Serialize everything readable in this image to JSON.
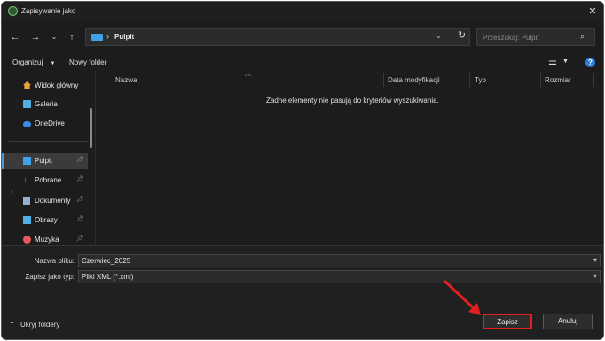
{
  "window": {
    "title": "Zapisywanie jako"
  },
  "nav": {
    "back_icon": "arrow-left-icon",
    "forward_icon": "arrow-right-icon",
    "recent_icon": "chevron-down-icon",
    "up_icon": "arrow-up-icon"
  },
  "address": {
    "path": "Pulpit"
  },
  "search": {
    "placeholder": "Przeszukaj: Pulpit"
  },
  "toolbar": {
    "organize_label": "Organizuj",
    "new_folder_label": "Nowy folder"
  },
  "sidebar": {
    "items": [
      {
        "label": "Widok główny",
        "icon": "home-icon",
        "color": "#e8a33a"
      },
      {
        "label": "Galeria",
        "icon": "gallery-icon",
        "color": "#4fb0e8"
      },
      {
        "label": "OneDrive",
        "icon": "cloud-icon",
        "color": "#3b8ee8"
      },
      {
        "label": "Pulpit",
        "icon": "desktop-folder-icon",
        "color": "#3fa3e8"
      },
      {
        "label": "Pobrane",
        "icon": "download-icon",
        "color": "#3fbf7f"
      },
      {
        "label": "Dokumenty",
        "icon": "documents-icon",
        "color": "#8fb0d0"
      },
      {
        "label": "Obrazy",
        "icon": "pictures-icon",
        "color": "#4fb0e8"
      },
      {
        "label": "Muzyka",
        "icon": "music-icon",
        "color": "#e85a5a"
      }
    ]
  },
  "columns": [
    "Nazwa",
    "Data modyfikacji",
    "Typ",
    "Rozmiar"
  ],
  "content": {
    "empty_message": "Żadne elementy nie pasują do kryteriów wyszukiwania."
  },
  "form": {
    "filename_label": "Nazwa pliku:",
    "filename_value": "Czerwiec_2025",
    "filetype_label": "Zapisz jako typ:",
    "filetype_value": "Pliki XML (*.xml)"
  },
  "footer": {
    "hide_folders_label": "Ukryj foldery",
    "save_label": "Zapisz",
    "cancel_label": "Anuluj"
  },
  "colors": {
    "accent": "#4a9ad8",
    "highlight": "#e22020"
  }
}
